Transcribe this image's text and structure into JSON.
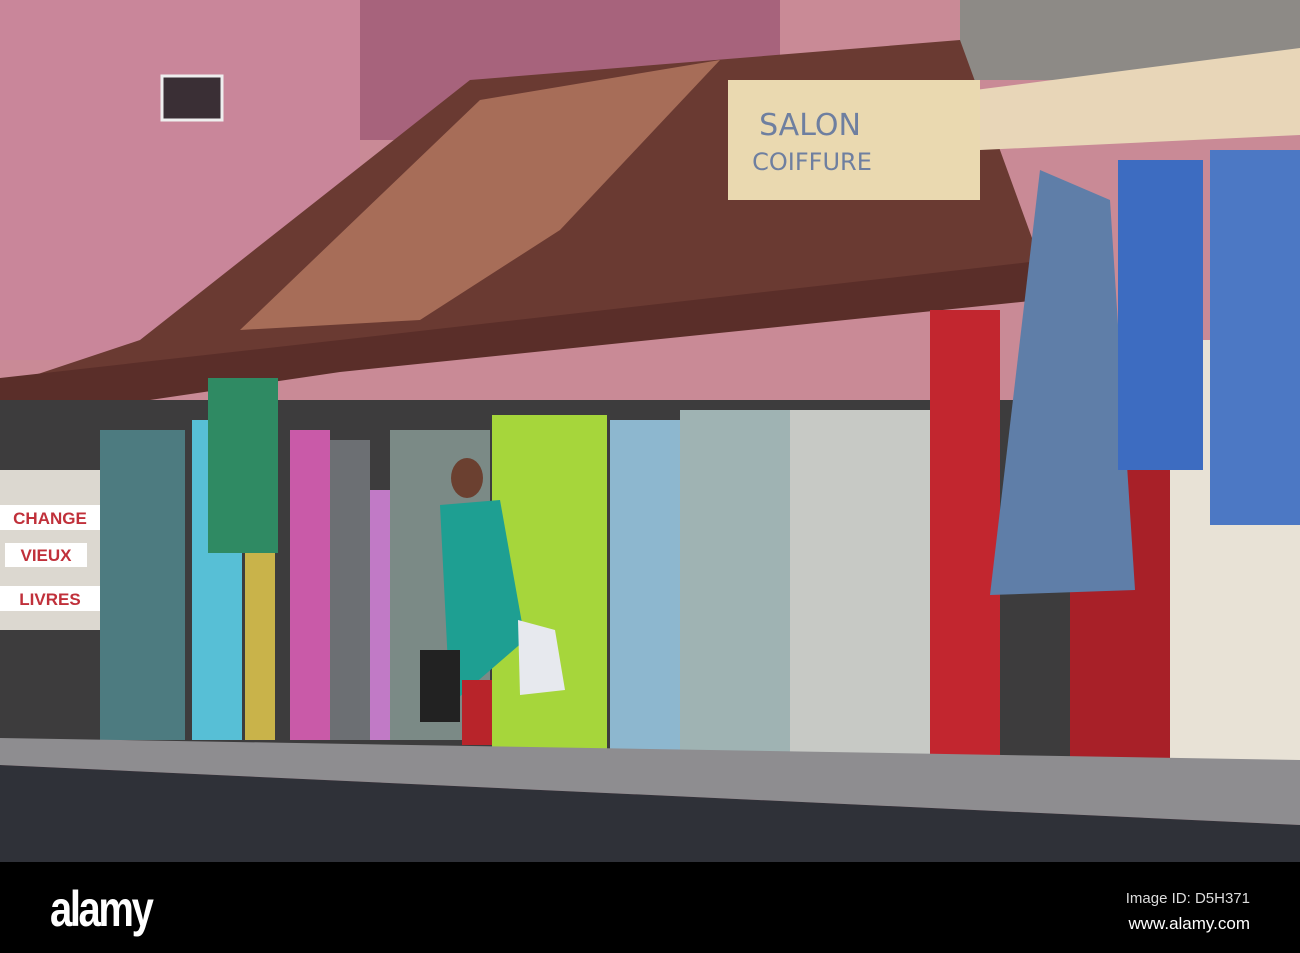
{
  "photo": {
    "salon_sign": {
      "line1": "SALON",
      "line2": "COIFFURE"
    },
    "book_shop_signs": [
      "CHANGE",
      "VIEUX",
      "LIVRES"
    ]
  },
  "footer": {
    "logo": "alamy",
    "image_id": "Image ID: D5H371",
    "website": "www.alamy.com"
  }
}
